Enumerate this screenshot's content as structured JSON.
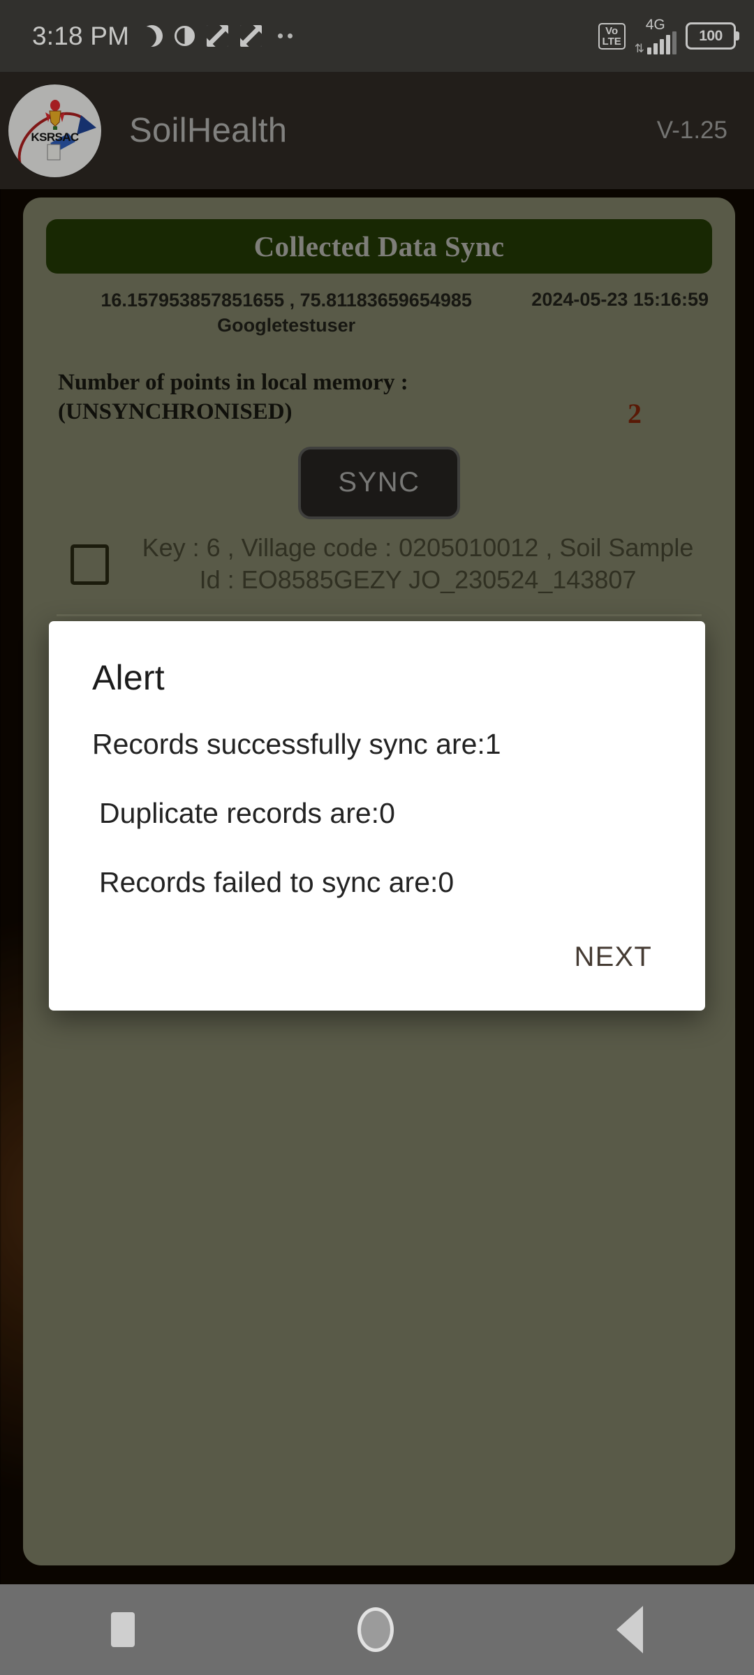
{
  "status_bar": {
    "time": "3:18 PM",
    "icons": [
      "moon-icon",
      "half-circle-icon",
      "image-icon",
      "image-icon",
      "more-dots-icon"
    ],
    "volte_top": "Vo",
    "volte_bottom": "LTE",
    "network": "4G",
    "battery": "100"
  },
  "app_bar": {
    "logo_text": "KSRSAC",
    "title": "SoilHealth",
    "version": "V-1.25"
  },
  "card": {
    "banner_title": "Collected Data Sync",
    "coordinates": "16.157953857851655 , 75.81183659654985",
    "username": "Googletestuser",
    "timestamp": "2024-05-23 15:16:59",
    "count_label": "Number of points in local memory : (UNSYNCHRONISED)",
    "count_value": "2",
    "sync_button": "SYNC",
    "record_row": "Key : 6 , Village code : 0205010012 , Soil Sample Id : EO8585GEZY JO_230524_143807"
  },
  "dialog": {
    "title": "Alert",
    "line1": "Records successfully sync are:1",
    "line2": "Duplicate records are:0",
    "line3": "Records failed to sync are:0",
    "next_button": "NEXT"
  },
  "nav_bar": {
    "recents": "recents-square-icon",
    "home": "home-circle-icon",
    "back": "back-triangle-icon"
  },
  "colors": {
    "card_bg": "#6d6e58",
    "banner_bg": "#1e3104",
    "accent_red": "#6d1f08",
    "status_bar_bg": "#3c3b38",
    "app_bar_bg": "#2a2520"
  }
}
